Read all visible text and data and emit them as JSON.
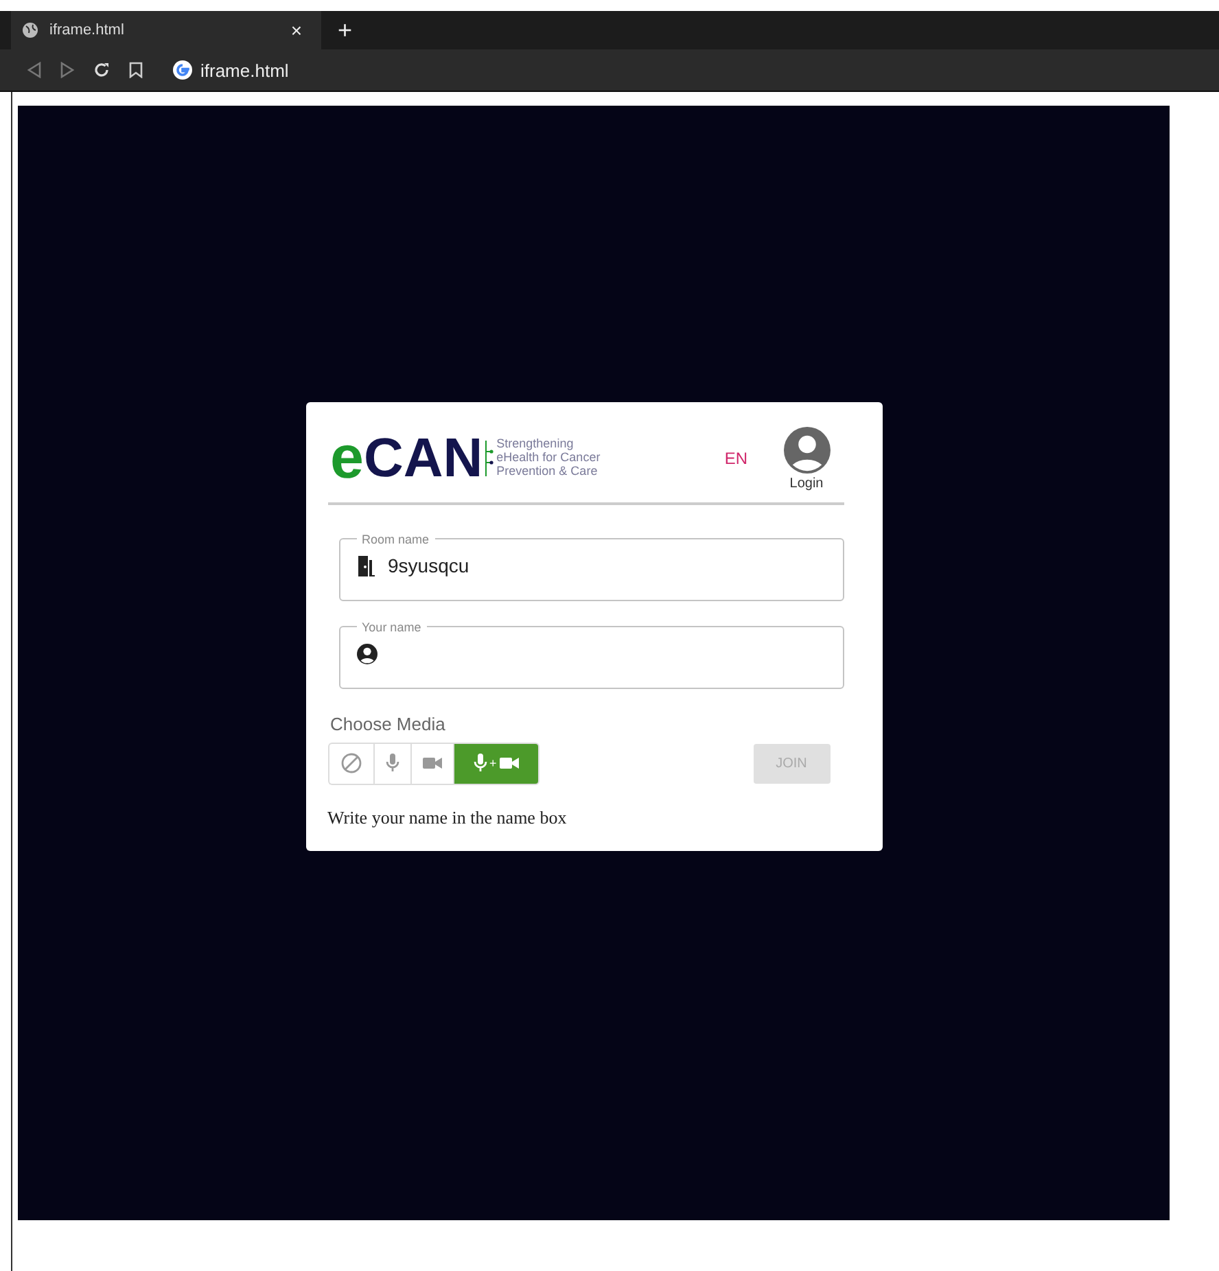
{
  "browser": {
    "tab": {
      "title": "iframe.html",
      "close": "×"
    },
    "new_tab": "+",
    "address": "iframe.html"
  },
  "card": {
    "logo": {
      "e": "e",
      "can": "CAN",
      "tagline": [
        "Strengthening",
        "eHealth for Cancer",
        "Prevention & Care"
      ]
    },
    "language": "EN",
    "login": "Login",
    "fields": [
      {
        "kind": "room",
        "label": "Room name",
        "value": "9syusqcu"
      },
      {
        "kind": "person",
        "label": "Your name"
      }
    ],
    "media": {
      "title": "Choose Media",
      "options": [
        {
          "kind": "none",
          "selected": false
        },
        {
          "kind": "audio",
          "selected": false
        },
        {
          "kind": "video",
          "selected": false
        },
        {
          "kind": "both",
          "selected": true,
          "plus": "+"
        }
      ]
    },
    "join": {
      "label": "JOIN",
      "disabled": true
    },
    "hint": "Write your name in the name box"
  }
}
